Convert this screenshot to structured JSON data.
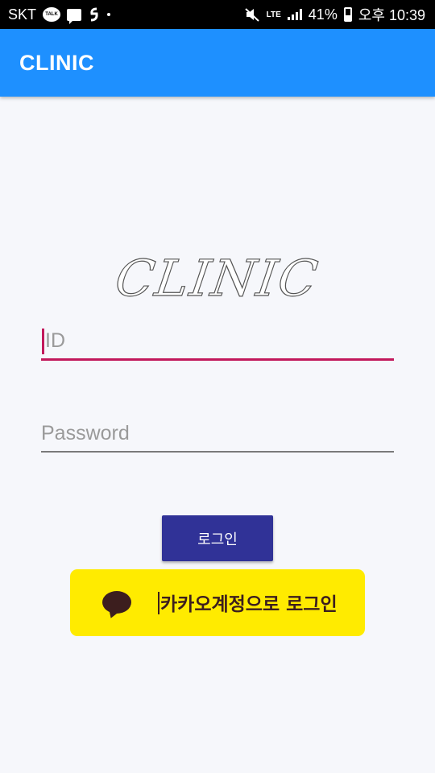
{
  "status_bar": {
    "carrier": "SKT",
    "talk_icon_text": "TALK",
    "network": "LTE",
    "battery": "41%",
    "time": "오후 10:39"
  },
  "app_bar": {
    "title": "CLINIC"
  },
  "logo": {
    "text": "CLINIC"
  },
  "form": {
    "id_placeholder": "ID",
    "password_placeholder": "Password",
    "login_label": "로그인",
    "kakao_label": "카카오계정으로 로그인"
  },
  "colors": {
    "app_bar": "#1e90ff",
    "accent": "#c2185b",
    "login_button": "#303297",
    "kakao": "#ffeb00"
  }
}
